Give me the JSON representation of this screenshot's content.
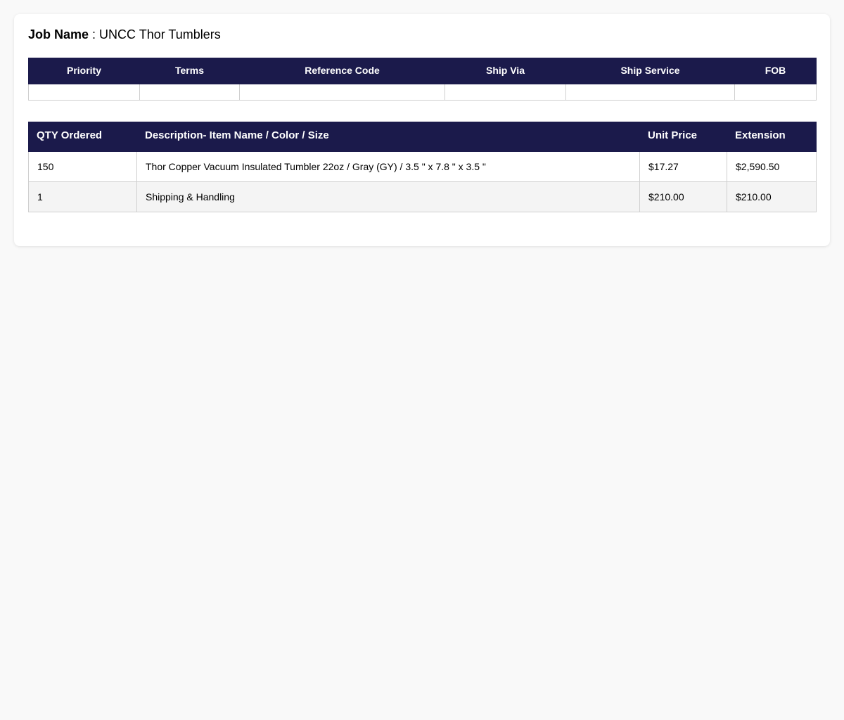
{
  "job": {
    "label": "Job Name",
    "separator": " : ",
    "value": "UNCC Thor Tumblers"
  },
  "order_meta": {
    "headers": [
      "Priority",
      "Terms",
      "Reference Code",
      "Ship Via",
      "Ship Service",
      "FOB"
    ],
    "values": [
      "",
      "",
      "",
      "",
      "",
      ""
    ]
  },
  "line_items": {
    "headers": [
      "QTY Ordered",
      "Description- Item Name / Color / Size",
      "Unit Price",
      "Extension"
    ],
    "rows": [
      {
        "qty": "150",
        "description": "Thor Copper Vacuum Insulated Tumbler 22oz / Gray (GY) / 3.5 \" x 7.8 \" x 3.5 \"",
        "unit_price": "$17.27",
        "extension": "$2,590.50"
      },
      {
        "qty": "1",
        "description": "Shipping & Handling",
        "unit_price": "$210.00",
        "extension": "$210.00"
      }
    ]
  },
  "colors": {
    "header_bg": "#1b1a4b",
    "header_text": "#ffffff",
    "page_bg": "#f9f9f9",
    "stripe_row": "#f4f4f4"
  }
}
